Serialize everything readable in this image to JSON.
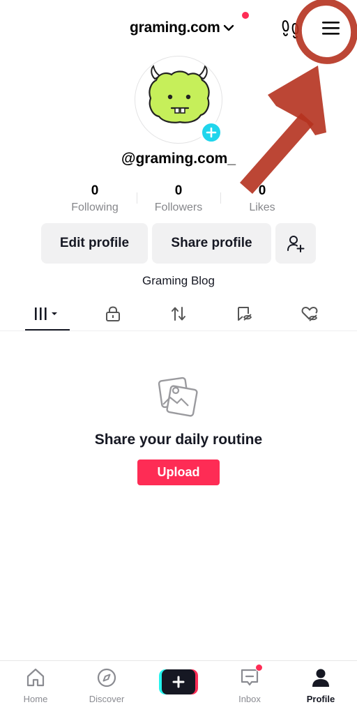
{
  "header": {
    "account_name": "graming.com",
    "has_notification": true
  },
  "profile": {
    "username": "@graming.com_",
    "bio": "Graming Blog",
    "stats": [
      {
        "value": "0",
        "label": "Following"
      },
      {
        "value": "0",
        "label": "Followers"
      },
      {
        "value": "0",
        "label": "Likes"
      }
    ]
  },
  "actions": {
    "edit_label": "Edit profile",
    "share_label": "Share profile"
  },
  "tabs": [
    {
      "icon": "grid-icon",
      "active": true
    },
    {
      "icon": "lock-icon",
      "active": false
    },
    {
      "icon": "repost-icon",
      "active": false
    },
    {
      "icon": "bookmark-hidden-icon",
      "active": false
    },
    {
      "icon": "liked-hidden-icon",
      "active": false
    }
  ],
  "empty_state": {
    "title": "Share your daily routine",
    "button_label": "Upload"
  },
  "bottom_nav": {
    "items": [
      {
        "label": "Home",
        "icon": "home-icon"
      },
      {
        "label": "Discover",
        "icon": "compass-icon"
      },
      {
        "label": "",
        "icon": "plus-icon"
      },
      {
        "label": "Inbox",
        "icon": "inbox-icon"
      },
      {
        "label": "Profile",
        "icon": "profile-icon"
      }
    ],
    "active": "Profile"
  },
  "colors": {
    "accent": "#fe2c55",
    "cyan": "#25f4ee",
    "annotation": "#b5321f",
    "avatar_green": "#c6ef5a"
  }
}
